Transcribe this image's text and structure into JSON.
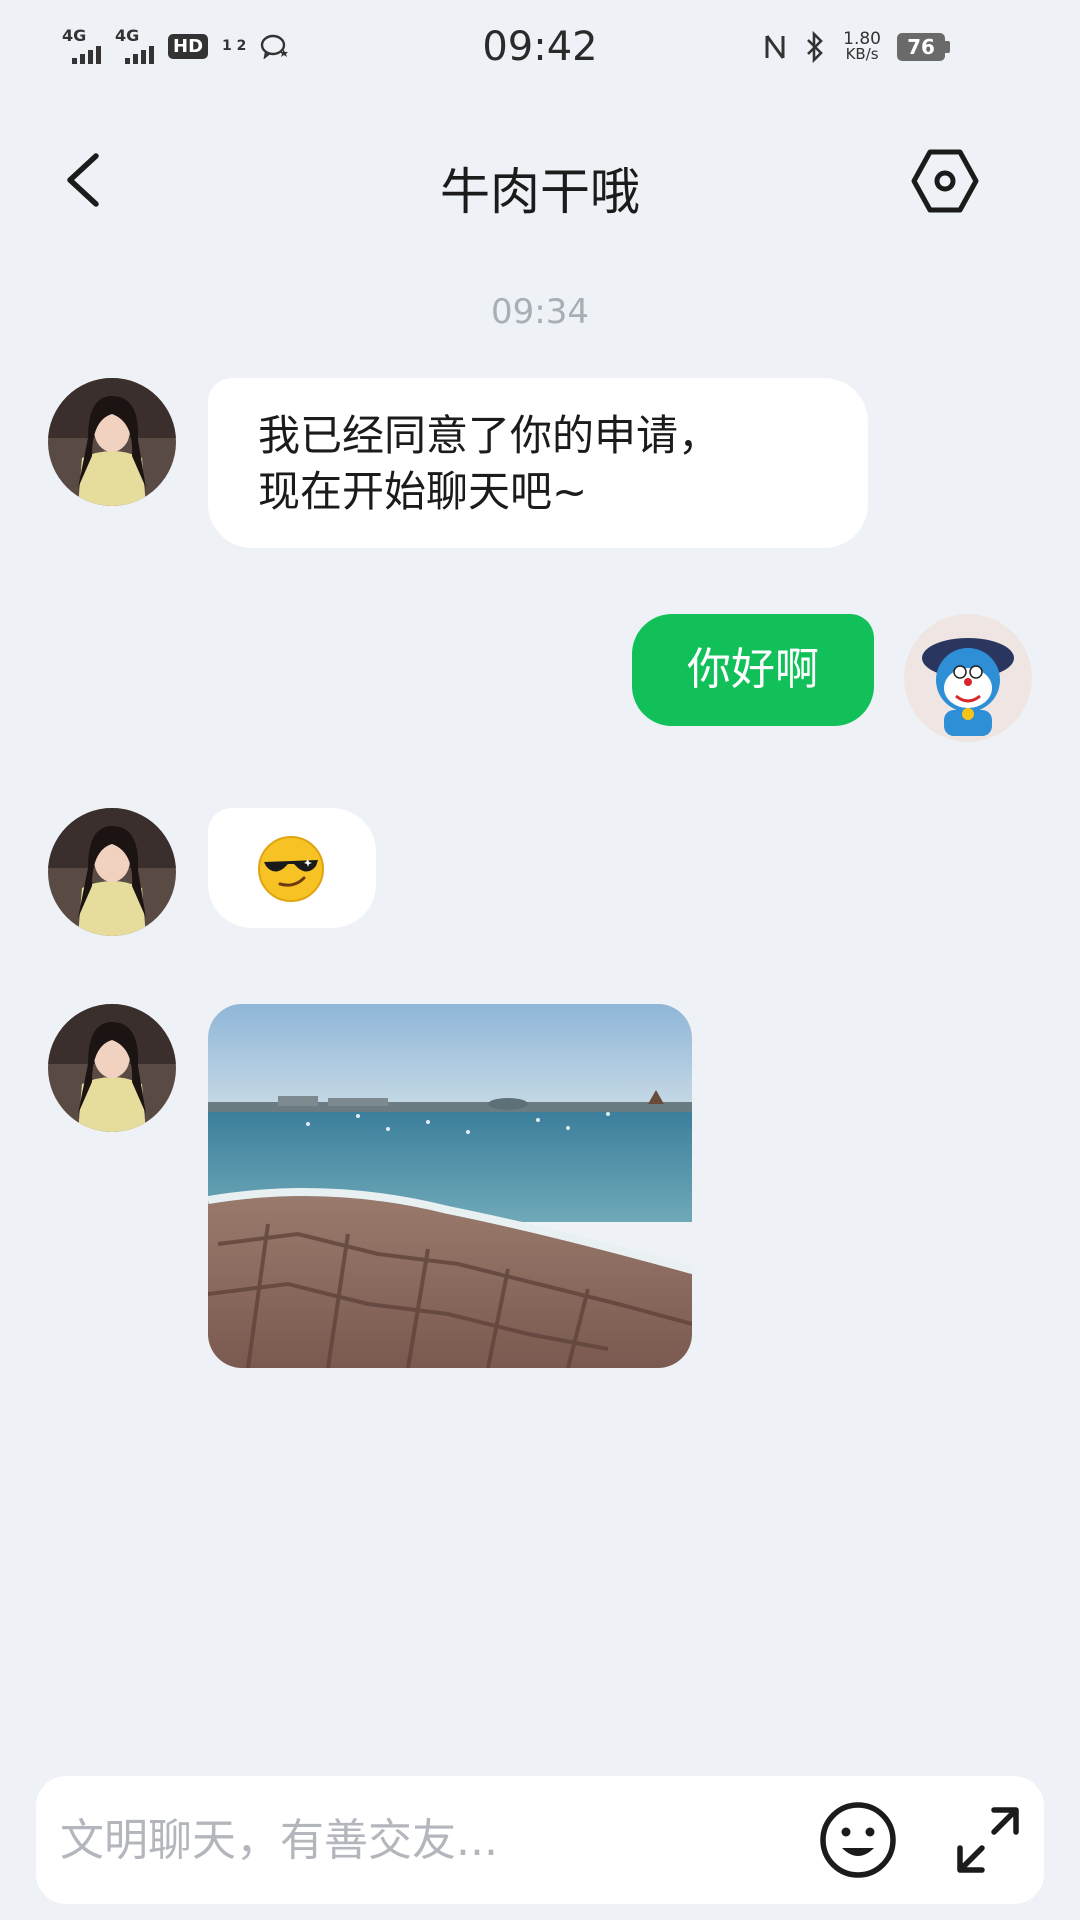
{
  "status_bar": {
    "time": "09:42",
    "signal_1_label": "4G",
    "signal_2_label": "4G",
    "hd_label": "HD",
    "hd_sub": "1 2",
    "net_speed_value": "1.80",
    "net_speed_unit": "KB/s",
    "battery": "76",
    "icons": [
      "signal-icon",
      "signal-icon",
      "hd-voice-icon",
      "wechat-icon",
      "nfc-icon",
      "bluetooth-icon",
      "battery-icon"
    ]
  },
  "header": {
    "title": "牛肉干哦",
    "back_icon": "chevron-left-icon",
    "settings_icon": "hexagon-settings-icon"
  },
  "chat": {
    "timestamp": "09:34",
    "messages": [
      {
        "from": "contact",
        "type": "text",
        "line1": "我已经同意了你的申请，",
        "line2": "现在开始聊天吧~"
      },
      {
        "from": "me",
        "type": "text",
        "text": "你好啊"
      },
      {
        "from": "contact",
        "type": "emoji",
        "emoji": "cool-sunglasses-emoji"
      },
      {
        "from": "contact",
        "type": "image",
        "image": "seaside-photo"
      }
    ]
  },
  "input": {
    "placeholder": "文明聊天，有善交友...",
    "value": "",
    "emoji_icon": "smiley-icon",
    "expand_icon": "expand-arrows-icon"
  },
  "colors": {
    "background": "#eef1f6",
    "outgoing_bubble": "#12c05a",
    "incoming_bubble": "#ffffff",
    "timestamp": "#a9adb5",
    "placeholder": "#b3b7bd"
  }
}
